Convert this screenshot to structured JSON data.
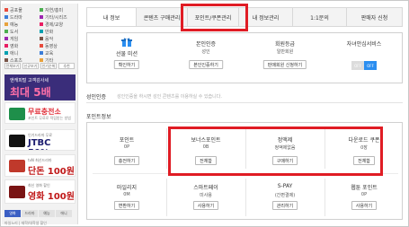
{
  "sidebar": {
    "menu": [
      [
        "공포물",
        "자연/흥미"
      ],
      [
        "드라마",
        "기타/시리즈"
      ],
      [
        "예능",
        "경제/교양"
      ],
      [
        "도서",
        "만화"
      ],
      [
        "게임",
        "음악"
      ],
      [
        "영화",
        "동영상"
      ],
      [
        "애니",
        "교육"
      ],
      [
        "스포츠",
        "기타"
      ]
    ],
    "menu_colors": [
      "#e84c3d",
      "#3b7dd8",
      "#e8a23d",
      "#4caf50",
      "#9c27b0",
      "#e91e63",
      "#00a0b0",
      "#795548"
    ],
    "mini_buttons": [
      "전체보기",
      "신규보기",
      "인기순위",
      "추천"
    ],
    "ads": {
      "ad1_line1": "앤캐피털 고객감사세",
      "ad1_line2": "최대 5배",
      "ad2_line1": "무료충전소",
      "ad2_line2": "포인트 무료로 적립받는 방법",
      "ad3_small": "인기드라마 무료",
      "ad3_big": "JTBC 50%",
      "ad4_small": "tvN 최신드라마",
      "ad4_big": "단돈 100원",
      "ad5_small": "최신 영화 할인",
      "ad5_big": "영화 100원"
    },
    "tabs": [
      "영화",
      "드라마",
      "예능",
      "애니"
    ],
    "footer": "파일노리 | 재학/대학생 할인"
  },
  "tabs": [
    "내 정보",
    "콘텐츠 구매관리",
    "포인트/쿠폰관리",
    "내 정보관리",
    "1:1문의",
    "판매자 신청"
  ],
  "services": [
    {
      "title": "선물 미션",
      "value": "",
      "button": "확인하기"
    },
    {
      "title": "본인인증",
      "value": "성인",
      "button": "본인인증하기"
    },
    {
      "title": "회원등급",
      "value": "일반회원",
      "button": "판매회원 신청하기"
    },
    {
      "title": "자녀안심서비스",
      "value": "",
      "toggle_off": "OFF",
      "toggle_on": "OFF"
    }
  ],
  "adult_section": {
    "label": "성인인증",
    "desc": "성인인증을 하시면 성인 콘텐츠를 이용하실 수 있습니다."
  },
  "points_label": "포인트정보",
  "points": [
    [
      {
        "title": "포인트",
        "value": "0P",
        "button": "충전하기"
      },
      {
        "title": "보너스포인트",
        "value": "0B",
        "button": "전체합"
      },
      {
        "title": "정액제",
        "value": "정액제없음",
        "button": "구매하기"
      },
      {
        "title": "다운로드 쿠폰",
        "value": "0장",
        "button": "전체합"
      }
    ],
    [
      {
        "title": "마일리지",
        "value": "0M",
        "button": "변환하기"
      },
      {
        "title": "스마트페이",
        "value": "미사용",
        "button": "사용하기"
      },
      {
        "title": "S-PAY",
        "value": "(간편결제)",
        "button": "관리하기"
      },
      {
        "title": "웹툰 포인트",
        "value": "0P",
        "button": "사용하기"
      }
    ]
  ],
  "colors": {
    "highlight": "#e01c24",
    "toggle_on": "#2b8ef0",
    "gift": "#2b8ef0"
  }
}
